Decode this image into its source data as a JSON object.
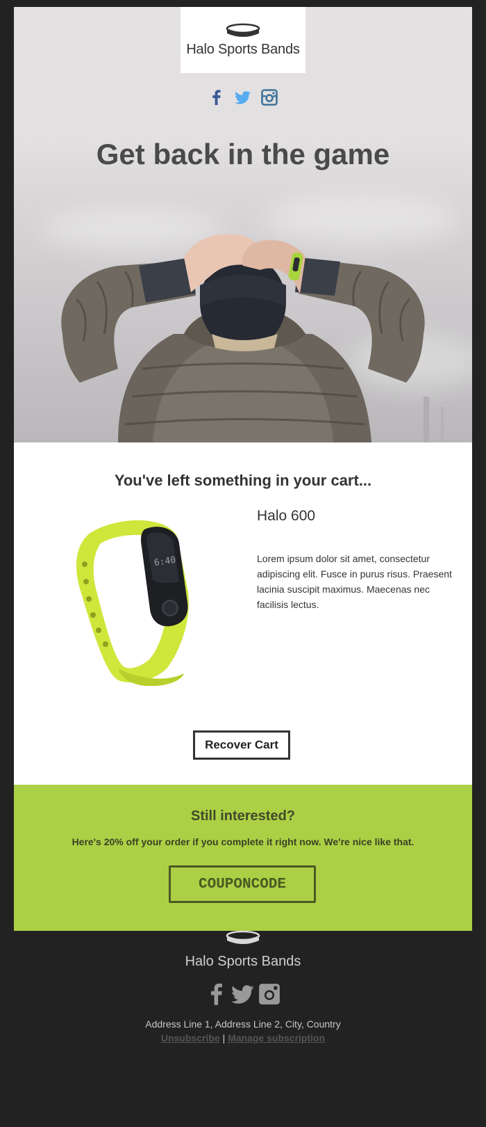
{
  "brand": {
    "name": "Halo Sports Bands",
    "accent_green": "#acd045"
  },
  "hero": {
    "title": "Get back in the game",
    "social_icons": [
      "facebook-icon",
      "twitter-icon",
      "instagram-icon"
    ]
  },
  "cart": {
    "heading": "You've left something in your cart...",
    "product_name": "Halo 600",
    "product_description": "Lorem ipsum dolor sit amet, consectetur adipiscing elit. Fusce in purus risus. Praesent lacinia suscipit maximus. Maecenas nec facilisis lectus.",
    "watch_time": "6:40",
    "button_label": "Recover Cart"
  },
  "coupon": {
    "title": "Still interested?",
    "text": "Here's 20% off your order if you complete it right now. We're nice like that.",
    "code": "COUPONCODE"
  },
  "footer": {
    "brand_name": "Halo Sports Bands",
    "address": "Address Line 1, Address Line 2, City, Country",
    "unsubscribe": "Unsubscribe",
    "separator": "|",
    "manage": "Manage subscription"
  }
}
